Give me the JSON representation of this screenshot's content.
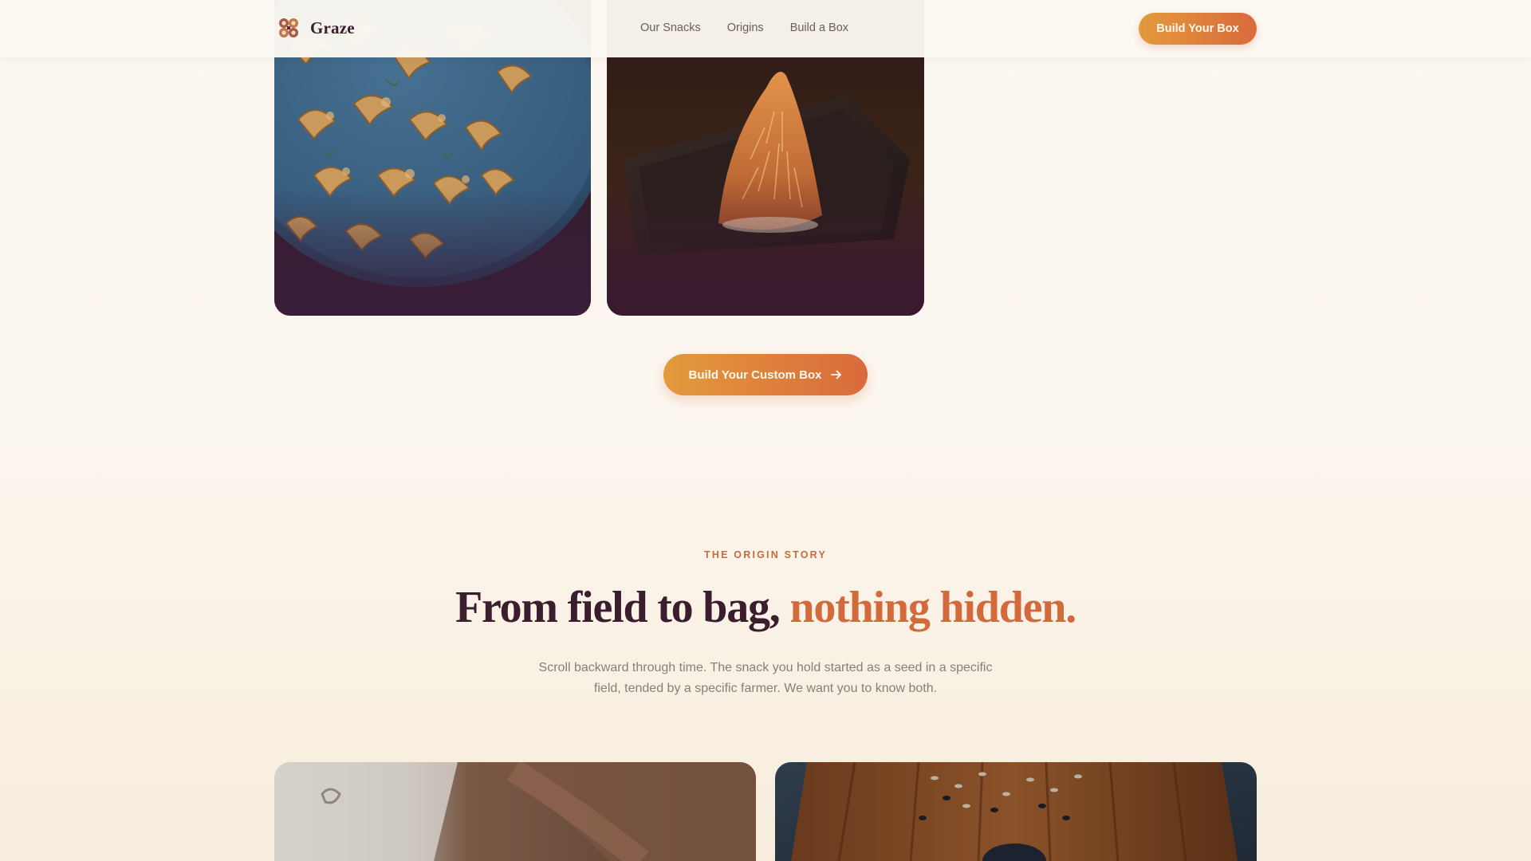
{
  "brand": {
    "name": "Graze",
    "logo_icon": "clover-pattern-icon"
  },
  "nav": {
    "links": [
      {
        "label": "Our Snacks"
      },
      {
        "label": "Origins"
      },
      {
        "label": "Build a Box"
      }
    ],
    "cta_label": "Build Your Box"
  },
  "gallery": {
    "images": [
      {
        "subject": "cashews-in-blue-bowl"
      },
      {
        "subject": "caramel-brittle-on-slate-plate"
      }
    ]
  },
  "custom_box": {
    "label": "Build Your Custom Box",
    "icon": "arrow-right-icon"
  },
  "origin": {
    "eyebrow": "THE ORIGIN STORY",
    "headline_main": "From field to bag, ",
    "headline_accent": "nothing hidden.",
    "body": "Scroll backward through time. The snack you hold started as a seed in a specific field, tended by a specific farmer. We want you to know both."
  },
  "colors": {
    "accent_orange": "#d96a3c",
    "accent_amber": "#e39a3c",
    "plum": "#3b1e2e",
    "background": "#fcf8f2"
  }
}
